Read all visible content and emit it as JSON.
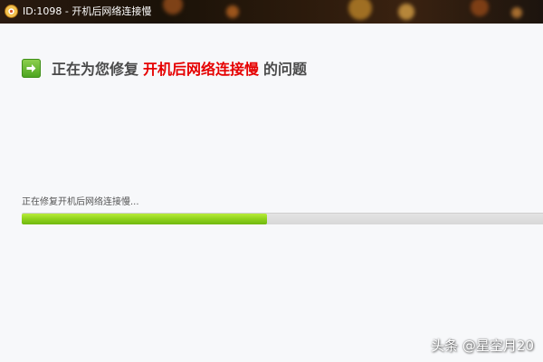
{
  "window": {
    "title": "ID:1098 - 开机后网络连接慢",
    "app_icon": "app-logo-icon"
  },
  "heading": {
    "prefix": "正在为您修复",
    "highlight": "开机后网络连接慢",
    "suffix": "的问题",
    "icon": "arrow-right-icon",
    "highlight_color": "#e60000"
  },
  "progress": {
    "status_text": "正在修复开机后网络连接慢...",
    "percent": 47,
    "fill_color": "#8fd21b"
  },
  "watermark": {
    "text": "头条 @星空月20"
  }
}
